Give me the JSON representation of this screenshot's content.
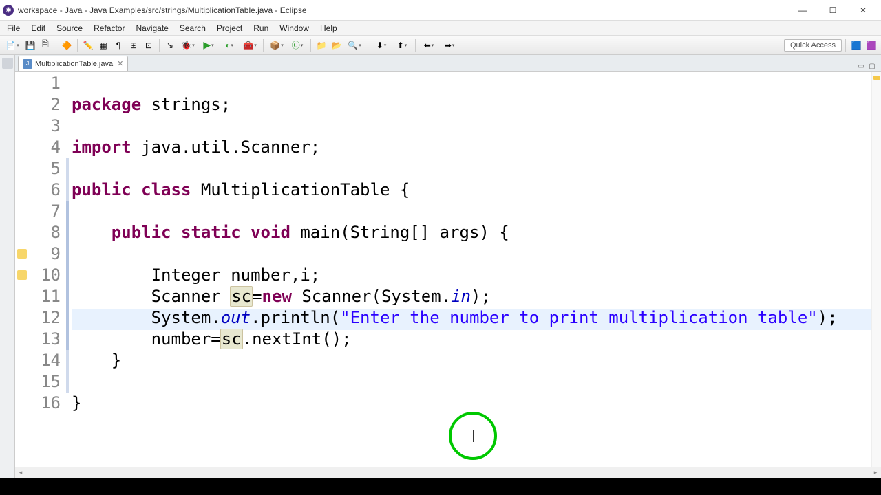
{
  "window": {
    "title": "workspace - Java - Java Examples/src/strings/MultiplicationTable.java - Eclipse"
  },
  "menu": {
    "items": [
      "File",
      "Edit",
      "Source",
      "Refactor",
      "Navigate",
      "Search",
      "Project",
      "Run",
      "Window",
      "Help"
    ]
  },
  "toolbar": {
    "quick_access": "Quick Access"
  },
  "tab": {
    "filename": "MultiplicationTable.java"
  },
  "editor": {
    "line_numbers": [
      1,
      2,
      3,
      4,
      5,
      6,
      7,
      8,
      9,
      10,
      11,
      12,
      13,
      14,
      15,
      16
    ],
    "current_line": 12,
    "warning_lines": [
      9,
      10
    ],
    "fold_ranges": [
      [
        5,
        15
      ],
      [
        7,
        13
      ]
    ],
    "code_lines": [
      {
        "tokens": [
          [
            "kw",
            "package"
          ],
          [
            "",
            " strings;"
          ]
        ]
      },
      {
        "tokens": []
      },
      {
        "tokens": [
          [
            "kw",
            "import"
          ],
          [
            "",
            " java.util.Scanner;"
          ]
        ]
      },
      {
        "tokens": []
      },
      {
        "tokens": [
          [
            "kw",
            "public"
          ],
          [
            "",
            " "
          ],
          [
            "kw",
            "class"
          ],
          [
            "",
            " MultiplicationTable {"
          ]
        ]
      },
      {
        "tokens": []
      },
      {
        "tokens": [
          [
            "",
            "    "
          ],
          [
            "kw",
            "public"
          ],
          [
            "",
            " "
          ],
          [
            "kw",
            "static"
          ],
          [
            "",
            " "
          ],
          [
            "kw",
            "void"
          ],
          [
            "",
            " main(String[] args) {"
          ]
        ]
      },
      {
        "tokens": []
      },
      {
        "tokens": [
          [
            "",
            "        Integer "
          ],
          [
            "u",
            "number"
          ],
          [
            "",
            ",i;"
          ]
        ]
      },
      {
        "tokens": [
          [
            "",
            "        Scanner "
          ],
          [
            "hl",
            "sc"
          ],
          [
            "",
            "="
          ],
          [
            "kw",
            "new"
          ],
          [
            "",
            " Scanner(System."
          ],
          [
            "field",
            "in"
          ],
          [
            "",
            ");"
          ]
        ]
      },
      {
        "tokens": [
          [
            "",
            "        System."
          ],
          [
            "field",
            "out"
          ],
          [
            "",
            ".println("
          ],
          [
            "str",
            "\"Enter the number to print multiplication table\""
          ],
          [
            "",
            ");"
          ]
        ]
      },
      {
        "tokens": [
          [
            "",
            "        number="
          ],
          [
            "hl",
            "sc"
          ],
          [
            "",
            ".nextInt();"
          ]
        ]
      },
      {
        "tokens": [
          [
            "",
            "    }"
          ]
        ]
      },
      {
        "tokens": []
      },
      {
        "tokens": [
          [
            "",
            "}"
          ]
        ]
      },
      {
        "tokens": []
      }
    ]
  }
}
